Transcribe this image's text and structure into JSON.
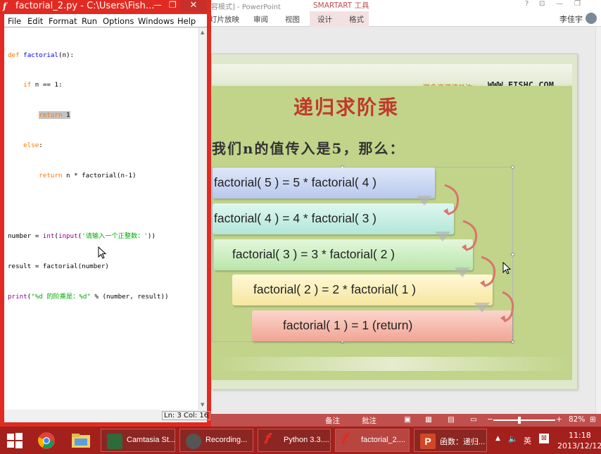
{
  "powerpoint": {
    "title_fragment": "容模式] - PowerPoint",
    "smartart_tools": "SMARTART 工具",
    "ribbon_tabs": [
      "灯片放映",
      "审阅",
      "视图",
      "设计",
      "格式"
    ],
    "user_name": "李佳宇",
    "window_controls": [
      "?",
      "⊡",
      "—",
      "❐"
    ],
    "status": {
      "notes": "备注",
      "comments": "批注",
      "zoom": "82%"
    }
  },
  "slide": {
    "follow_text": "更多资源请关注：",
    "url": "WWW.FISHC.COM",
    "title": "递归求阶乘",
    "subtitle": "我们n的值传入是5，那么：",
    "steps": [
      "factorial( 5 ) = 5 * factorial( 4 )",
      "factorial( 4 ) = 4 * factorial( 3 )",
      "factorial( 3 ) = 3 * factorial( 2 )",
      "factorial( 2 ) = 2 * factorial( 1 )",
      "factorial( 1 ) = 1  (return)"
    ],
    "step_colors": [
      "#c9d6f2",
      "#c6eee4",
      "#cdeec4",
      "#fbf1c2",
      "#f6bfb5"
    ]
  },
  "idle": {
    "title": "factorial_2.py - C:\\Users\\Fish...",
    "min_glyph": "—",
    "max_glyph": "❐",
    "close_glyph": "✕",
    "menus": [
      "File",
      "Edit",
      "Format",
      "Run",
      "Options",
      "Windows",
      "Help"
    ],
    "code": {
      "l1_kw": "def",
      "l1_name": "factorial",
      "l1_rest": "(n):",
      "l2_kw": "if",
      "l2_rest": " n == 1:",
      "l3_kw": "return",
      "l3_rest": " 1",
      "l4_kw": "else",
      "l4_rest": ":",
      "l5_kw": "return",
      "l5_rest": " n * factorial(n-1)",
      "l7_a": "number = ",
      "l7_bi1": "int",
      "l7_b": "(",
      "l7_bi2": "input",
      "l7_c": "(",
      "l7_str": "'请输入一个正整数：'",
      "l7_d": "))",
      "l8": "result = factorial(number)",
      "l9_bi": "print",
      "l9_a": "(",
      "l9_str": "\"%d 的阶乘是：%d\"",
      "l9_b": " % (number, result))"
    },
    "status": "Ln: 3 Col: 16"
  },
  "taskbar": {
    "tasks": [
      "Camtasia St...",
      "Recording...",
      "Python 3.3....",
      "factorial_2....",
      "函数：递归..."
    ],
    "tray_lang": "英",
    "time": "11:18",
    "date": "2013/12/12"
  },
  "colors": {
    "theme_red": "#e12b22",
    "taskbar": "#a3201c",
    "slide_green": "#c1d48a",
    "slide_title": "#c0392b"
  }
}
